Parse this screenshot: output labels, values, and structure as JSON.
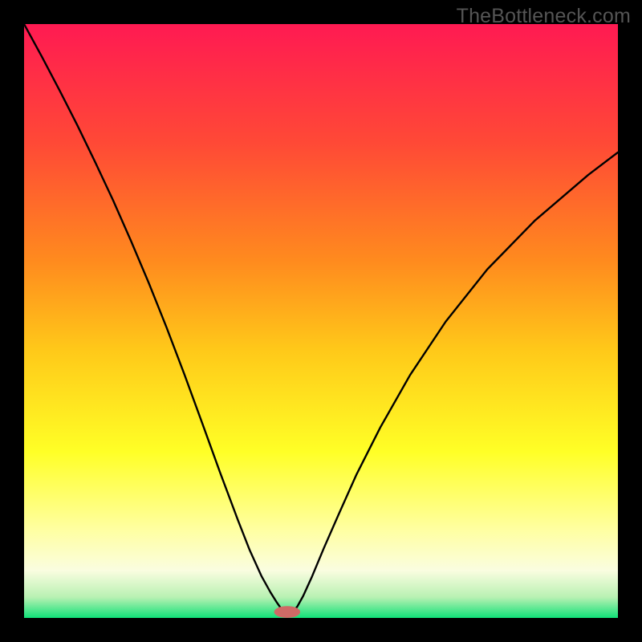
{
  "watermark": "TheBottleneck.com",
  "chart_data": {
    "type": "line",
    "title": "",
    "xlabel": "",
    "ylabel": "",
    "xlim": [
      0,
      100
    ],
    "ylim": [
      0,
      100
    ],
    "grid": false,
    "legend": false,
    "background_gradient": [
      {
        "offset": 0.0,
        "color": "#ff1a52"
      },
      {
        "offset": 0.2,
        "color": "#ff4936"
      },
      {
        "offset": 0.4,
        "color": "#ff8b1e"
      },
      {
        "offset": 0.55,
        "color": "#ffc919"
      },
      {
        "offset": 0.72,
        "color": "#ffff26"
      },
      {
        "offset": 0.85,
        "color": "#ffffa0"
      },
      {
        "offset": 0.92,
        "color": "#fafde0"
      },
      {
        "offset": 0.965,
        "color": "#b9f1b3"
      },
      {
        "offset": 1.0,
        "color": "#10e178"
      }
    ],
    "series": [
      {
        "name": "bottleneck-curve",
        "color": "#000000",
        "x": [
          0,
          3,
          6,
          9,
          12,
          15,
          18,
          21,
          24,
          27,
          30,
          33,
          36,
          38,
          40,
          41.5,
          42.5,
          43.2,
          43.8,
          44.3,
          45.3,
          46,
          47,
          48.5,
          50.5,
          53,
          56,
          60,
          65,
          71,
          78,
          86,
          95,
          100
        ],
        "y": [
          100,
          94.5,
          88.8,
          82.9,
          76.7,
          70.3,
          63.5,
          56.4,
          48.9,
          41.0,
          32.8,
          24.5,
          16.5,
          11.4,
          7.0,
          4.3,
          2.7,
          1.7,
          1.1,
          0.8,
          1.1,
          1.9,
          3.7,
          7.0,
          11.8,
          17.5,
          24.2,
          32.1,
          40.9,
          49.9,
          58.7,
          66.9,
          74.6,
          78.4
        ]
      }
    ],
    "marker": {
      "name": "optimal-point",
      "x": 44.3,
      "y": 0.0,
      "color": "#cf6a66",
      "rx": 2.2,
      "ry": 1.0
    }
  }
}
